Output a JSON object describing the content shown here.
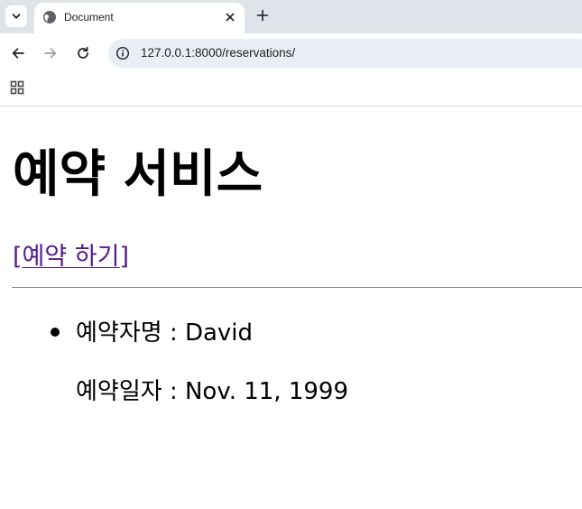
{
  "browser": {
    "tab": {
      "title": "Document"
    },
    "address_bar": {
      "url": "127.0.0.1:8000/reservations/"
    }
  },
  "page": {
    "title": "예약 서비스",
    "reserve_link": {
      "open_bracket": "[",
      "label": "예약 하기",
      "close_bracket": "]"
    },
    "reservations": [
      {
        "name_line": "예약자명 : David",
        "date_line": "예약일자 : Nov. 11, 1999"
      }
    ]
  },
  "colors": {
    "tabstrip_bg": "#dfe3ea",
    "omnibox_bg": "#e9eef6",
    "visited_link": "#551a8b"
  }
}
